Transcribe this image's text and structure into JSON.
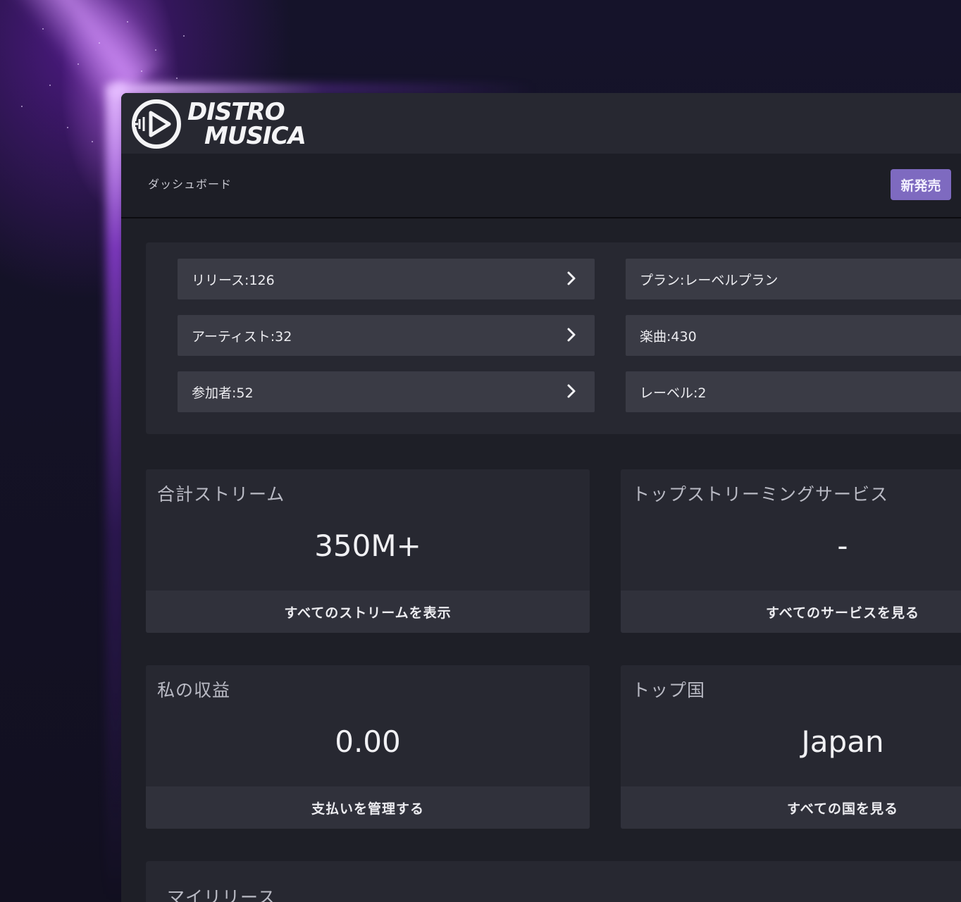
{
  "app": {
    "logo_line1": "DISTRO",
    "logo_line2": "MUSICA",
    "accent_color": "#7e6ac0"
  },
  "header": {
    "breadcrumb": "ダッシュボード",
    "new_release_label": "新発売"
  },
  "summary": {
    "left": [
      {
        "label": "リリース:126",
        "icon": "chevron-right-icon"
      },
      {
        "label": "アーティスト:32",
        "icon": "chevron-right-icon"
      },
      {
        "label": "参加者:52",
        "icon": "chevron-right-icon"
      }
    ],
    "right": [
      {
        "label": "プラン:レーベルプラン"
      },
      {
        "label": "楽曲:430"
      },
      {
        "label": "レーベル:2"
      }
    ]
  },
  "metrics": {
    "total_streams": {
      "title": "合計ストリーム",
      "value": "350M+",
      "action": "すべてのストリームを表示"
    },
    "top_services": {
      "title": "トップストリーミングサービス",
      "value": "-",
      "action": "すべてのサービスを見る"
    },
    "earnings": {
      "title": "私の収益",
      "value": "0.00",
      "action": "支払いを管理する"
    },
    "top_country": {
      "title": "トップ国",
      "value": "Japan",
      "action": "すべての国を見る"
    }
  },
  "releases": {
    "title": "マイリリース"
  }
}
